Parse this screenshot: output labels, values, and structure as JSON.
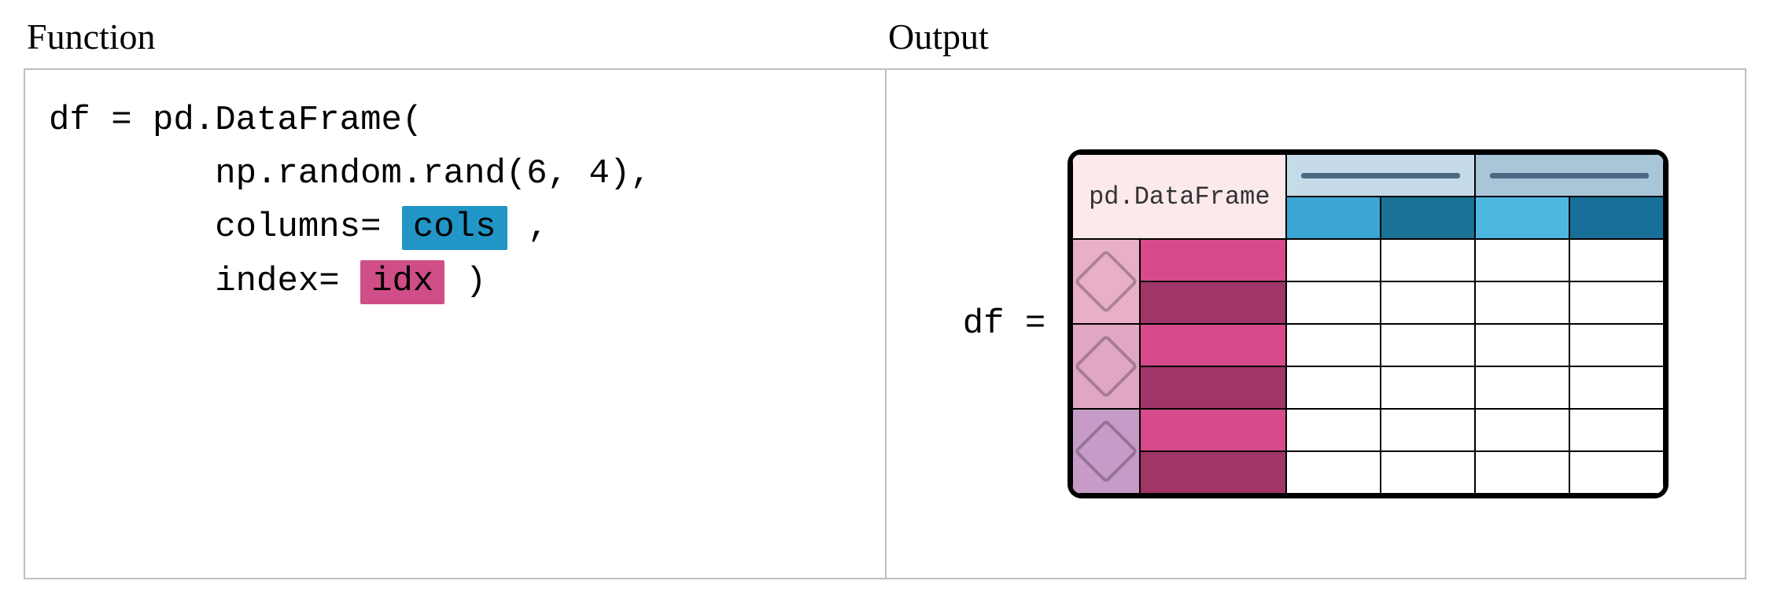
{
  "headings": {
    "function": "Function",
    "output": "Output"
  },
  "code": {
    "line1_a": "df = pd.DataFrame(",
    "line2_a": "        np.random.rand(6, 4),",
    "line3_a": "        columns= ",
    "line3_hl": "cols",
    "line3_b": " ,",
    "line4_a": "        index= ",
    "line4_hl": "idx",
    "line4_b": " )"
  },
  "output": {
    "label": "df =",
    "corner_label": "pd.DataFrame"
  },
  "diagram": {
    "rows": 6,
    "cols": 4,
    "row_index_levels": 2,
    "col_index_levels": 2,
    "row_outer_groups": 3,
    "col_outer_groups": 2,
    "colors": {
      "corner_bg": "#fbe9ec",
      "col_top": [
        "#c6dbe9",
        "#a9c6d9"
      ],
      "col_bot": [
        "#3aa6d1",
        "#1a7296",
        "#4db7df",
        "#177099"
      ],
      "row_outer": [
        "#e9aec8",
        "#e1a6c2",
        "#c79bc7"
      ],
      "row_inner_alt": [
        "#d64b8b",
        "#a03567"
      ],
      "cols_highlight": "#2196c6",
      "idx_highlight": "#d04e87"
    }
  }
}
